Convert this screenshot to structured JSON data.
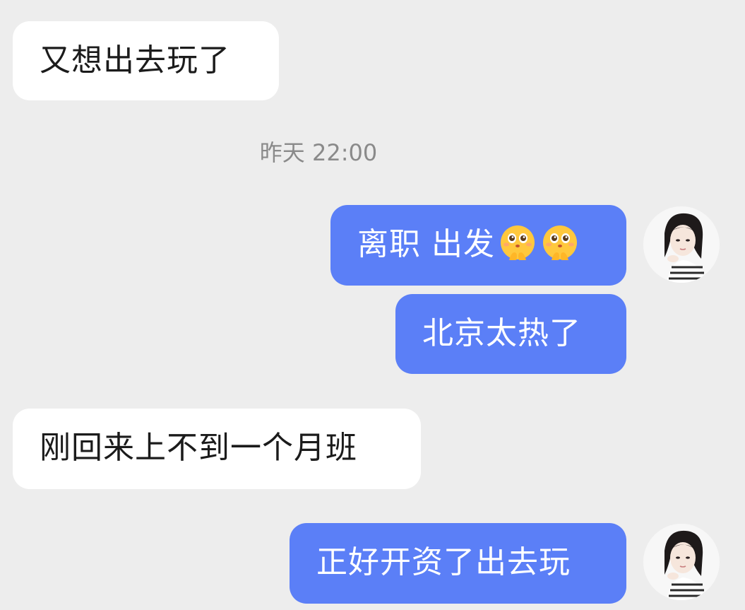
{
  "messages": [
    {
      "side": "in",
      "text": "又想出去玩了"
    },
    {
      "side": "out",
      "text": "离职 出发",
      "emojis": [
        "pleading-hands-emoji",
        "pleading-hands-emoji"
      ]
    },
    {
      "side": "out",
      "text": "北京太热了"
    },
    {
      "side": "in",
      "text": "刚回来上不到一个月班"
    },
    {
      "side": "out",
      "text": "正好开资了出去玩"
    }
  ],
  "timestamp": "昨天 22:00",
  "colors": {
    "background": "#ededed",
    "incoming_bubble": "#ffffff",
    "outgoing_bubble": "#5b7ff7",
    "timestamp_text": "#8a8a8a"
  }
}
